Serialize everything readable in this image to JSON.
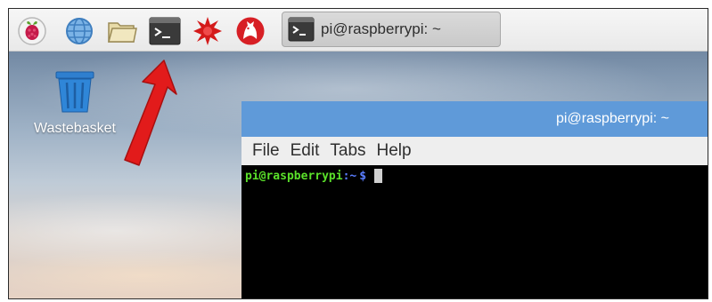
{
  "taskbar": {
    "icons": [
      "raspberry-menu-icon",
      "web-browser-icon",
      "file-manager-icon",
      "terminal-icon",
      "math-kernel-icon",
      "wolfram-icon"
    ],
    "task_button": {
      "label": "pi@raspberrypi: ~",
      "icon": "terminal-icon"
    }
  },
  "desktop": {
    "wastebasket": {
      "label": "Wastebasket",
      "icon": "trash-icon"
    }
  },
  "terminal": {
    "title": "pi@raspberrypi: ~",
    "menu": [
      "File",
      "Edit",
      "Tabs",
      "Help"
    ],
    "prompt": {
      "user_host": "pi@raspberrypi",
      "path": ":~",
      "symbol": "$"
    }
  },
  "colors": {
    "titlebar": "#5f9ad9",
    "terminal_bg": "#000000",
    "prompt_user": "#5ae02a",
    "prompt_path": "#5a7dff",
    "arrow": "#e21b1b"
  }
}
